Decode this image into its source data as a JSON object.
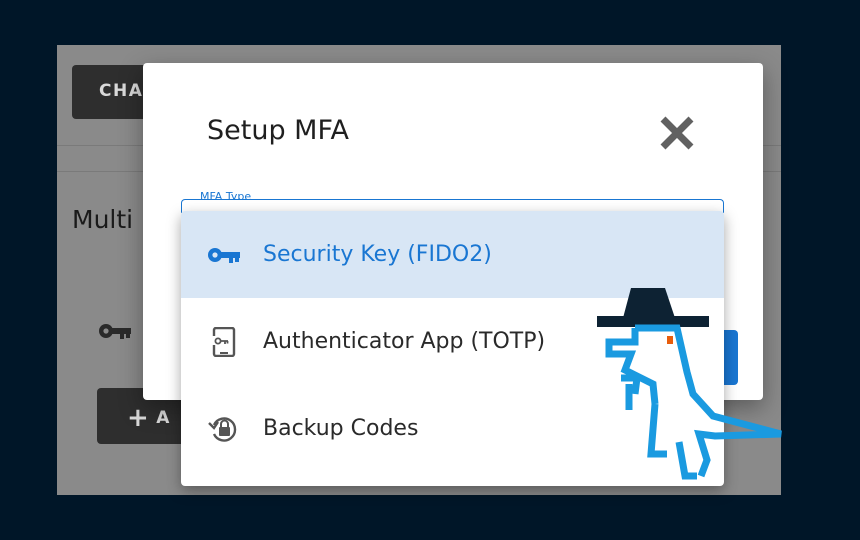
{
  "background_page": {
    "change_button_label": "CHA",
    "heading": "Multi",
    "add_button_label": "A"
  },
  "dialog": {
    "title": "Setup MFA",
    "close_icon": "close-icon",
    "field_label": "MFA Type"
  },
  "menu": {
    "items": [
      {
        "label": "Security Key (FIDO2)",
        "icon": "key-icon",
        "selected": true
      },
      {
        "label": "Authenticator App (TOTP)",
        "icon": "phone-key-icon",
        "selected": false
      },
      {
        "label": "Backup Codes",
        "icon": "backup-lock-icon",
        "selected": false
      }
    ]
  },
  "colors": {
    "accent": "#1976d2",
    "selected_bg": "#d8e6f5",
    "page_bg": "#001628",
    "mascot": "#1a9ae0"
  }
}
